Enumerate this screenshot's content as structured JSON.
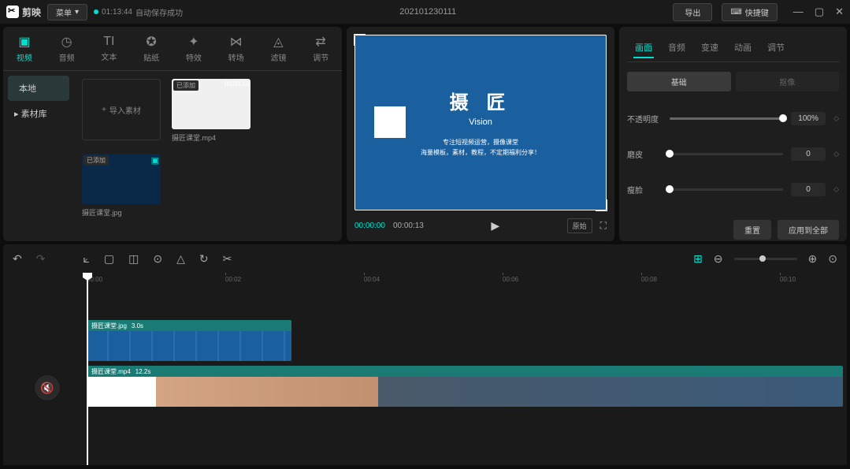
{
  "titlebar": {
    "app_name": "剪映",
    "menu_label": "菜单",
    "autosave_time": "01:13:44",
    "autosave_text": "自动保存成功",
    "project_name": "202101230111",
    "export_label": "导出",
    "shortcut_label": "快捷键"
  },
  "media_tabs": [
    {
      "icon": "▣",
      "label": "视频"
    },
    {
      "icon": "◷",
      "label": "音频"
    },
    {
      "icon": "TI",
      "label": "文本"
    },
    {
      "icon": "✪",
      "label": "贴纸"
    },
    {
      "icon": "✦",
      "label": "特效"
    },
    {
      "icon": "⋈",
      "label": "转场"
    },
    {
      "icon": "◬",
      "label": "滤镜"
    },
    {
      "icon": "⇄",
      "label": "调节"
    }
  ],
  "media_side": {
    "local": "本地",
    "library": "素材库"
  },
  "import_label": "导入素材",
  "thumbs": [
    {
      "name": "摄匠课堂.mp4",
      "badge": "已添加",
      "duration": "00:00:13",
      "type": "vid"
    },
    {
      "name": "摄匠课堂.jpg",
      "badge": "已添加",
      "type": "img"
    }
  ],
  "preview": {
    "title": "摄 匠",
    "subtitle": "Vision",
    "line1": "专注短视频运营，摄像课堂",
    "line2": "海量模板，素材，教程，不定期福利分享！",
    "current": "00:00:00",
    "total": "00:00:13",
    "ratio": "原始"
  },
  "props": {
    "tabs": [
      "画面",
      "音频",
      "变速",
      "动画",
      "调节"
    ],
    "sub_basic": "基础",
    "sub_cutout": "抠像",
    "opacity_label": "不透明度",
    "opacity_value": "100%",
    "skin_label": "磨皮",
    "skin_value": "0",
    "face_label": "瘦脸",
    "face_value": "0",
    "reset": "重置",
    "apply_all": "应用到全部"
  },
  "timeline": {
    "ticks": [
      "00:00",
      "00:02",
      "00:04",
      "00:06",
      "00:08",
      "00:10"
    ],
    "clip1_name": "摄匠课堂.jpg",
    "clip1_dur": "3.0s",
    "clip2_name": "摄匠课堂.mp4",
    "clip2_dur": "12.2s"
  }
}
